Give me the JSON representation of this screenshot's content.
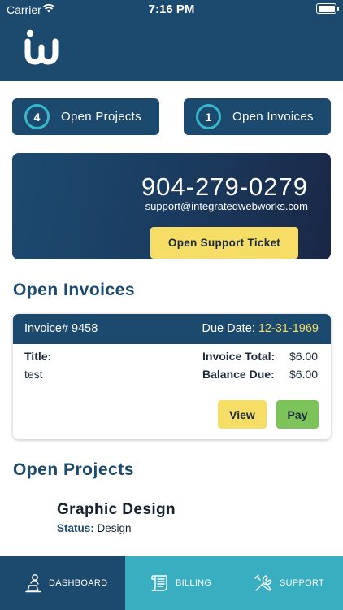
{
  "status_bar": {
    "carrier": "Carrier",
    "time": "7:16 PM"
  },
  "summary": {
    "open_projects_count": "4",
    "open_projects_label": "Open Projects",
    "open_invoices_count": "1",
    "open_invoices_label": "Open Invoices"
  },
  "support": {
    "phone": "904-279-0279",
    "email": "support@integratedwebworks.com",
    "ticket_label": "Open Support Ticket"
  },
  "invoices_section_title": "Open Invoices",
  "invoice": {
    "number_label": "Invoice# 9458",
    "due_label": "Due Date:",
    "due_date": "12-31-1969",
    "title_label": "Title:",
    "title_value": "test",
    "total_label": "Invoice Total:",
    "total_value": "$6.00",
    "balance_label": "Balance Due:",
    "balance_value": "$6.00",
    "view_label": "View",
    "pay_label": "Pay"
  },
  "projects_section_title": "Open Projects",
  "project": {
    "name": "Graphic Design",
    "status_label": "Status:",
    "status_value": "Design"
  },
  "tabs": [
    {
      "label": "DASHBOARD",
      "icon": "dashboard-icon"
    },
    {
      "label": "BILLING",
      "icon": "billing-icon"
    },
    {
      "label": "SUPPORT",
      "icon": "support-icon"
    }
  ],
  "colors": {
    "navy": "#1c4a6e",
    "teal": "#39aec0",
    "yellow": "#f6de66",
    "green": "#7cc35a"
  }
}
